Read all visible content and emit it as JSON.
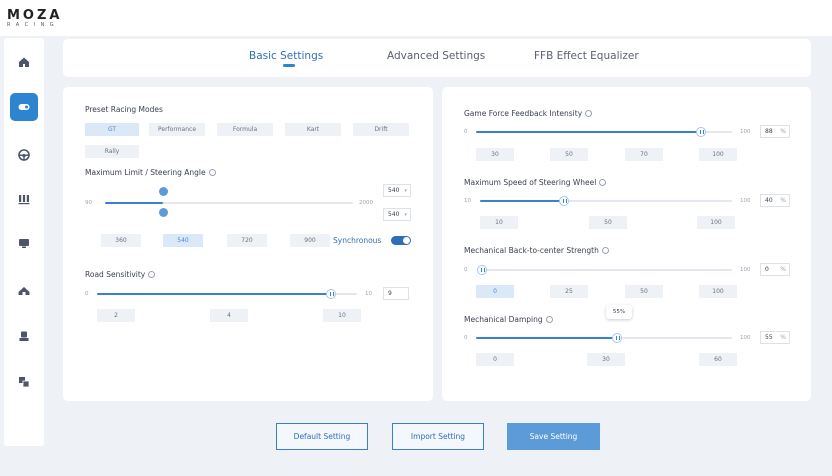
{
  "app": {
    "logo_main": "MOZA",
    "logo_sub": "RACING"
  },
  "sidebar": {
    "items": [
      {
        "icon": "home-icon",
        "active": false
      },
      {
        "icon": "wheelbase-icon",
        "active": true
      },
      {
        "icon": "steering-wheel-icon",
        "active": false
      },
      {
        "icon": "pedals-icon",
        "active": false
      },
      {
        "icon": "dashboard-icon",
        "active": false
      },
      {
        "icon": "shifter-icon",
        "active": false
      },
      {
        "icon": "handbrake-icon",
        "active": false
      },
      {
        "icon": "multi-device-icon",
        "active": false
      }
    ]
  },
  "tabs": [
    {
      "label": "Basic Settings",
      "active": true
    },
    {
      "label": "Advanced Settings",
      "active": false
    },
    {
      "label": "FFB Effect Equalizer",
      "active": false
    }
  ],
  "left_panel": {
    "preset_modes": {
      "label": "Preset Racing Modes",
      "options": [
        "GT",
        "Performance",
        "Formula",
        "Kart",
        "Drift",
        "Rally"
      ],
      "selected": "GT"
    },
    "steering_angle": {
      "label": "Maximum Limit / Steering Angle",
      "min_label": "90",
      "max_label": "2000",
      "min": 90,
      "max": 2000,
      "limit_value": 540,
      "angle_value": 540,
      "limit_box": "540",
      "angle_box": "540",
      "presets": [
        "360",
        "540",
        "720",
        "900"
      ],
      "selected_preset": "540",
      "sync_label": "Synchronous",
      "sync_on": true
    },
    "road_sensitivity": {
      "label": "Road Sensitivity",
      "min_label": "0",
      "max_label": "10",
      "min": 0,
      "max": 10,
      "value": 9,
      "value_box": "9",
      "presets": [
        "2",
        "4",
        "10"
      ]
    }
  },
  "right_panel": {
    "ffb_intensity": {
      "label": "Game Force Feedback Intensity",
      "min_label": "0",
      "max_label": "100",
      "min": 0,
      "max": 100,
      "value": 88,
      "value_box": "88",
      "unit": "%",
      "presets": [
        "30",
        "50",
        "70",
        "100"
      ]
    },
    "max_speed": {
      "label": "Maximum Speed of Steering Wheel",
      "min_label": "10",
      "max_label": "100",
      "min": 10,
      "max": 100,
      "value": 40,
      "value_box": "40",
      "unit": "%",
      "presets": [
        "10",
        "50",
        "100"
      ]
    },
    "back_to_center": {
      "label": "Mechanical Back-to-center Strength",
      "min_label": "0",
      "max_label": "100",
      "min": 0,
      "max": 100,
      "value": 0,
      "value_box": "0",
      "unit": "%",
      "presets": [
        "0",
        "25",
        "50",
        "100"
      ],
      "selected_preset": "0"
    },
    "damping": {
      "label": "Mechanical Damping",
      "min_label": "0",
      "max_label": "100",
      "min": 0,
      "max": 100,
      "value": 55,
      "value_box": "55",
      "unit": "%",
      "tooltip": "55%",
      "presets": [
        "0",
        "30",
        "60"
      ]
    }
  },
  "buttons": {
    "default": "Default Setting",
    "import": "Import Setting",
    "save": "Save Setting"
  },
  "colors": {
    "accent": "#2f84cf",
    "fill": "#3b7fd0",
    "background": "#eef1f6"
  }
}
